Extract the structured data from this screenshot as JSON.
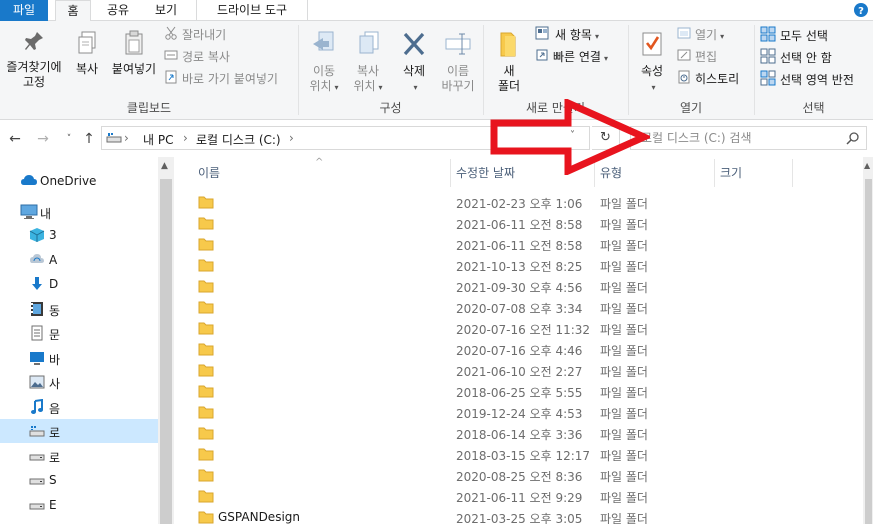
{
  "ribbon_tabs": {
    "file": "파일",
    "home": "홈",
    "share": "공유",
    "view": "보기",
    "drive_tools": "드라이브 도구"
  },
  "clipboard": {
    "pin_label_line1": "즐겨찾기에",
    "pin_label_line2": "고정",
    "copy_label": "복사",
    "paste_label": "붙여넣기",
    "cut_label": "잘라내기",
    "copy_path_label": "경로 복사",
    "paste_shortcut_label": "바로 가기 붙여넣기",
    "group_label": "클립보드"
  },
  "organize": {
    "move_to_line1": "이동",
    "move_to_line2": "위치",
    "copy_to_line1": "복사",
    "copy_to_line2": "위치",
    "delete_label": "삭제",
    "rename_line1": "이름",
    "rename_line2": "바꾸기",
    "group_label": "구성"
  },
  "new": {
    "new_folder_line1": "새",
    "new_folder_line2": "폴더",
    "new_item_label": "새 항목",
    "easy_access_label": "빠른 연결",
    "group_label": "새로 만들기"
  },
  "open": {
    "properties_label": "속성",
    "open_label": "열기",
    "edit_label": "편집",
    "history_label": "히스토리",
    "group_label": "열기"
  },
  "select": {
    "select_all_label": "모두 선택",
    "select_none_label": "선택 안 함",
    "invert_label": "선택 영역 반전",
    "group_label": "선택"
  },
  "address": {
    "this_pc": "내 PC",
    "local_disk": "로컬 디스크 (C:)",
    "search_placeholder": "로컬 디스크 (C:) 검색"
  },
  "nav_pane": {
    "onedrive": "OneDrive",
    "this_pc": "내",
    "items": [
      {
        "label": "3",
        "icon": "3d-objects-icon"
      },
      {
        "label": "A",
        "icon": "cloud-sync-icon"
      },
      {
        "label": "D",
        "icon": "downloads-icon"
      },
      {
        "label": "동",
        "icon": "videos-icon"
      },
      {
        "label": "문",
        "icon": "documents-icon"
      },
      {
        "label": "바",
        "icon": "desktop-icon"
      },
      {
        "label": "사",
        "icon": "pictures-icon"
      },
      {
        "label": "음",
        "icon": "music-icon"
      },
      {
        "label": "로",
        "icon": "local-disk-icon",
        "selected": true
      },
      {
        "label": "로",
        "icon": "drive-icon"
      },
      {
        "label": "S",
        "icon": "drive-icon"
      },
      {
        "label": "E",
        "icon": "drive-icon"
      }
    ]
  },
  "columns": {
    "name": "이름",
    "modified": "수정한 날짜",
    "type": "유형",
    "size": "크기"
  },
  "files": [
    {
      "name": "",
      "date": "2021-02-23 오후 1:06",
      "type": "파일 폴더"
    },
    {
      "name": "",
      "date": "2021-06-11 오전 8:58",
      "type": "파일 폴더"
    },
    {
      "name": "",
      "date": "2021-06-11 오전 8:58",
      "type": "파일 폴더"
    },
    {
      "name": "",
      "date": "2021-10-13 오전 8:25",
      "type": "파일 폴더"
    },
    {
      "name": "",
      "date": "2021-09-30 오후 4:56",
      "type": "파일 폴더"
    },
    {
      "name": "",
      "date": "2020-07-08 오후 3:34",
      "type": "파일 폴더"
    },
    {
      "name": "",
      "date": "2020-07-16 오전 11:32",
      "type": "파일 폴더"
    },
    {
      "name": "",
      "date": "2020-07-16 오후 4:46",
      "type": "파일 폴더"
    },
    {
      "name": "",
      "date": "2021-06-10 오전 2:27",
      "type": "파일 폴더"
    },
    {
      "name": "",
      "date": "2018-06-25 오후 5:55",
      "type": "파일 폴더"
    },
    {
      "name": "",
      "date": "2019-12-24 오후 4:53",
      "type": "파일 폴더"
    },
    {
      "name": "",
      "date": "2018-06-14 오후 3:36",
      "type": "파일 폴더"
    },
    {
      "name": "",
      "date": "2018-03-15 오후 12:17",
      "type": "파일 폴더"
    },
    {
      "name": "",
      "date": "2020-08-25 오전 8:36",
      "type": "파일 폴더"
    },
    {
      "name": "",
      "date": "2021-06-11 오전 9:29",
      "type": "파일 폴더"
    },
    {
      "name": "GSPANDesign",
      "date": "2021-03-25 오후 3:05",
      "type": "파일 폴더"
    }
  ],
  "colors": {
    "file_tab": "#1979ca",
    "selection": "#cce8ff",
    "folder": "#f7c94b",
    "annotation_arrow": "#e8141e"
  }
}
